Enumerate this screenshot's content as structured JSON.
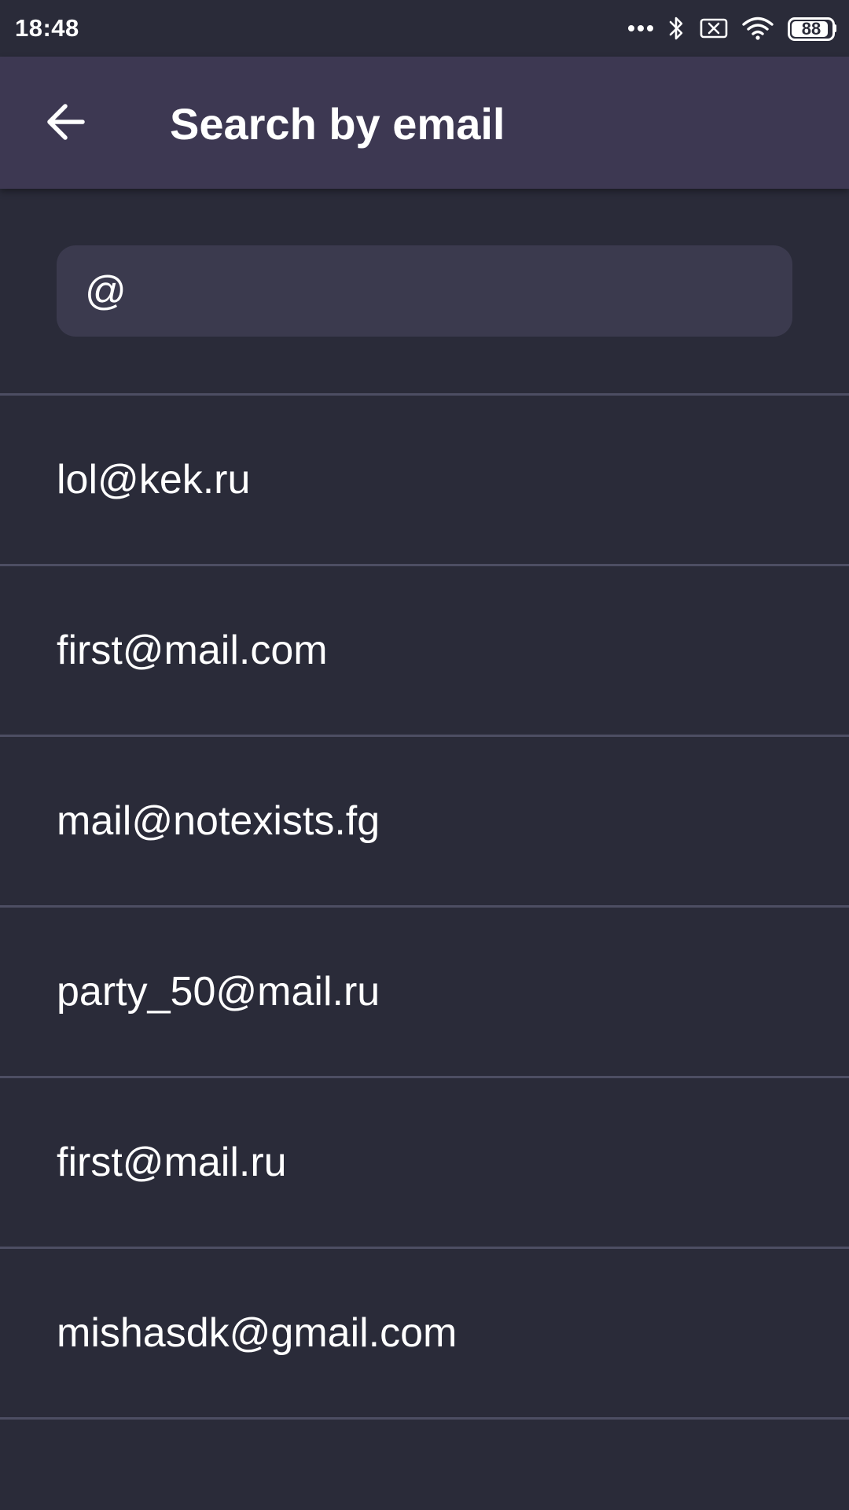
{
  "status_bar": {
    "time": "18:48",
    "battery_level": "88",
    "icons": [
      "more-dots-icon",
      "bluetooth-icon",
      "no-sim-icon",
      "wifi-icon",
      "battery-icon"
    ]
  },
  "app_bar": {
    "title": "Search by email",
    "back_icon": "arrow-back-icon",
    "background_color": "#3d3852"
  },
  "search": {
    "value": "@",
    "background_color": "#3b3a4e"
  },
  "results": [
    {
      "email": "lol@kek.ru"
    },
    {
      "email": "first@mail.com"
    },
    {
      "email": "mail@notexists.fg"
    },
    {
      "email": "party_50@mail.ru"
    },
    {
      "email": "first@mail.ru"
    },
    {
      "email": "mishasdk@gmail.com"
    }
  ],
  "colors": {
    "background": "#2a2b39",
    "divider": "#4d4e63",
    "text": "#ffffff"
  }
}
